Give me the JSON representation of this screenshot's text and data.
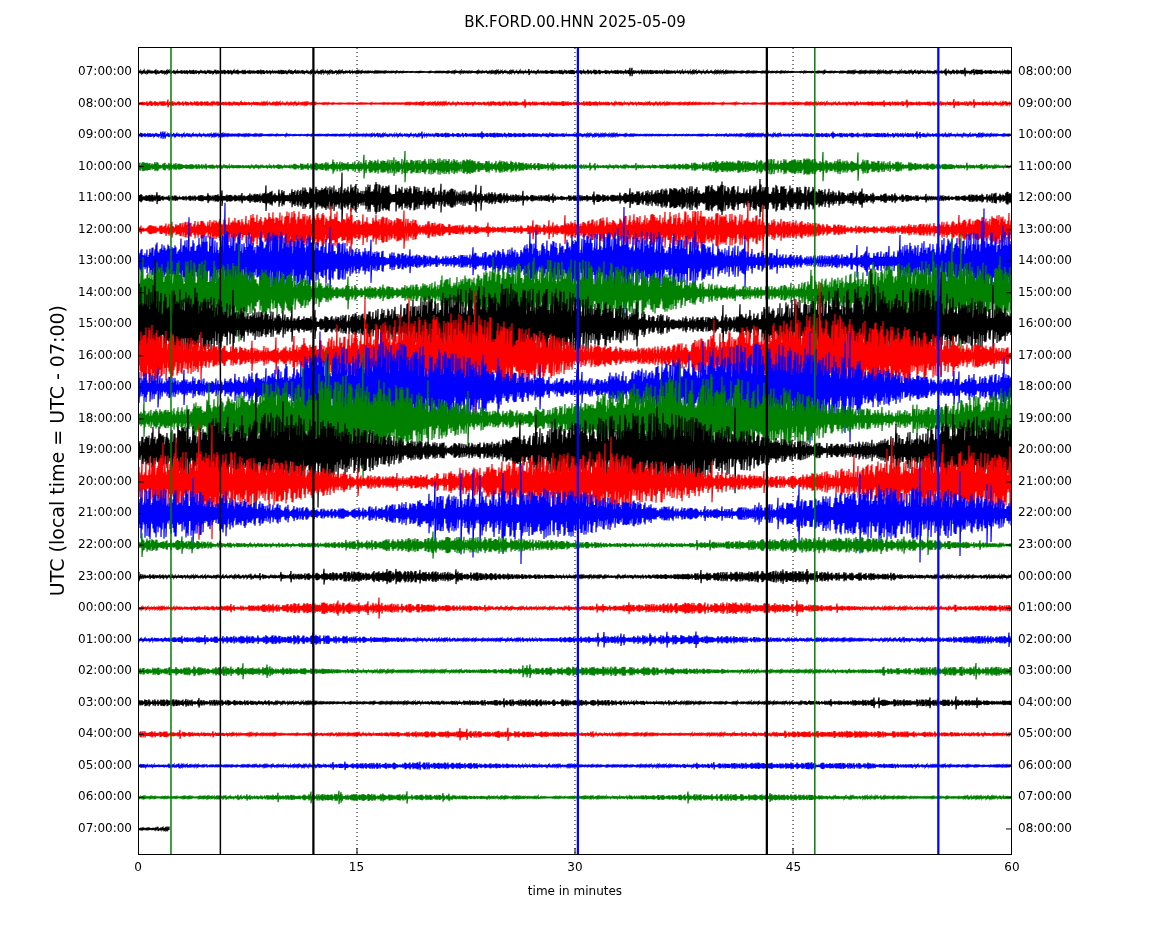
{
  "title": "BK.FORD.00.HNN 2025-05-09",
  "ylabel": "UTC (local time = UTC - 07:00)",
  "xlabel": "time in minutes",
  "xticks": [
    "0",
    "15",
    "30",
    "45",
    "60"
  ],
  "traces": [
    {
      "label_left": "07:00:00",
      "label_right": "08:00:00",
      "color": "#000000"
    },
    {
      "label_left": "08:00:00",
      "label_right": "09:00:00",
      "color": "#ff0000"
    },
    {
      "label_left": "09:00:00",
      "label_right": "10:00:00",
      "color": "#0000ff"
    },
    {
      "label_left": "10:00:00",
      "label_right": "11:00:00",
      "color": "#008000"
    },
    {
      "label_left": "11:00:00",
      "label_right": "12:00:00",
      "color": "#000000"
    },
    {
      "label_left": "12:00:00",
      "label_right": "13:00:00",
      "color": "#ff0000"
    },
    {
      "label_left": "13:00:00",
      "label_right": "14:00:00",
      "color": "#0000ff"
    },
    {
      "label_left": "14:00:00",
      "label_right": "15:00:00",
      "color": "#008000"
    },
    {
      "label_left": "15:00:00",
      "label_right": "16:00:00",
      "color": "#000000"
    },
    {
      "label_left": "16:00:00",
      "label_right": "17:00:00",
      "color": "#ff0000"
    },
    {
      "label_left": "17:00:00",
      "label_right": "18:00:00",
      "color": "#0000ff"
    },
    {
      "label_left": "18:00:00",
      "label_right": "19:00:00",
      "color": "#008000"
    },
    {
      "label_left": "19:00:00",
      "label_right": "20:00:00",
      "color": "#000000"
    },
    {
      "label_left": "20:00:00",
      "label_right": "21:00:00",
      "color": "#ff0000"
    },
    {
      "label_left": "21:00:00",
      "label_right": "22:00:00",
      "color": "#0000ff"
    },
    {
      "label_left": "22:00:00",
      "label_right": "23:00:00",
      "color": "#008000"
    },
    {
      "label_left": "23:00:00",
      "label_right": "00:00:00",
      "color": "#000000"
    },
    {
      "label_left": "00:00:00",
      "label_right": "01:00:00",
      "color": "#ff0000"
    },
    {
      "label_left": "01:00:00",
      "label_right": "02:00:00",
      "color": "#0000ff"
    },
    {
      "label_left": "02:00:00",
      "label_right": "03:00:00",
      "color": "#008000"
    },
    {
      "label_left": "03:00:00",
      "label_right": "04:00:00",
      "color": "#000000"
    },
    {
      "label_left": "04:00:00",
      "label_right": "05:00:00",
      "color": "#ff0000"
    },
    {
      "label_left": "05:00:00",
      "label_right": "06:00:00",
      "color": "#0000ff"
    },
    {
      "label_left": "06:00:00",
      "label_right": "07:00:00",
      "color": "#008000"
    },
    {
      "label_left": "07:00:00",
      "label_right": "08:00:00",
      "color": "#000000"
    }
  ]
}
